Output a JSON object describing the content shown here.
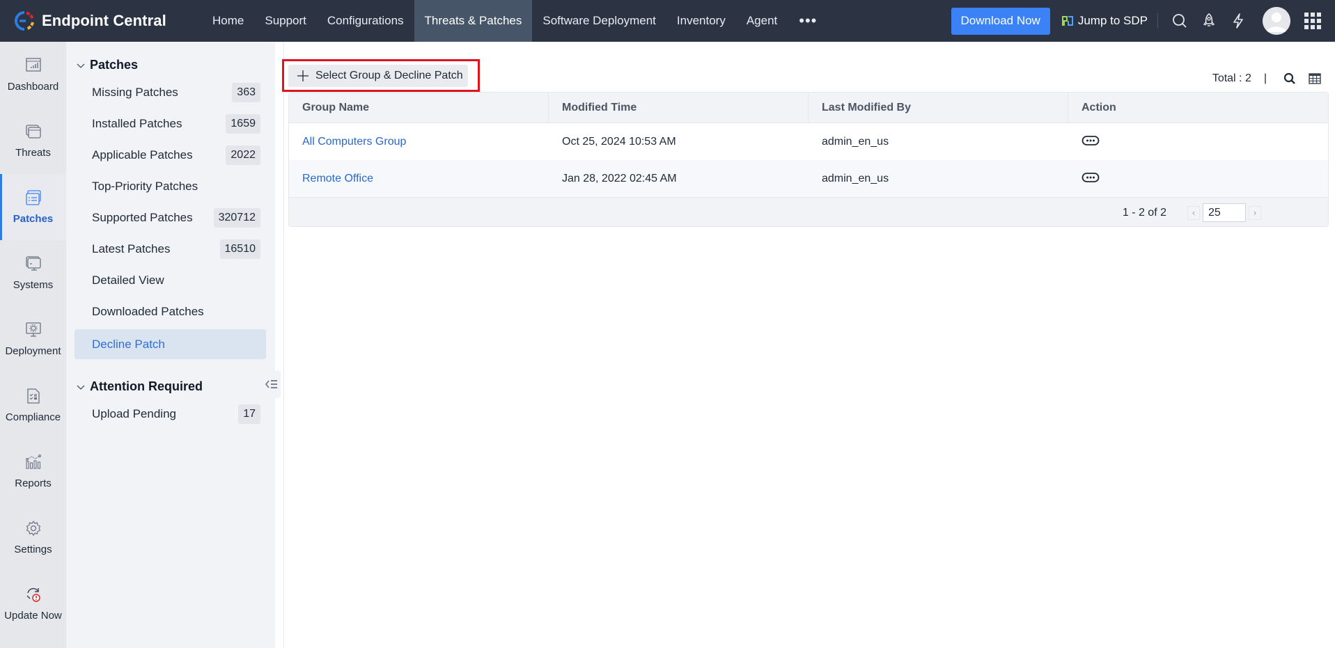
{
  "app": {
    "name": "Endpoint Central",
    "logo_colors": [
      "#2f7de1",
      "#d8262f",
      "#f0b445"
    ]
  },
  "topnav": {
    "items": [
      {
        "label": "Home",
        "active": false
      },
      {
        "label": "Support",
        "active": false
      },
      {
        "label": "Configurations",
        "active": false
      },
      {
        "label": "Threats & Patches",
        "active": true
      },
      {
        "label": "Software Deployment",
        "active": false
      },
      {
        "label": "Inventory",
        "active": false
      },
      {
        "label": "Agent",
        "active": false
      }
    ],
    "more_label": "•••",
    "download_label": "Download Now",
    "jump_label": "Jump to SDP",
    "icons": [
      "search-icon",
      "rocket-icon",
      "lightning-icon",
      "avatar",
      "apps-grid-icon"
    ]
  },
  "rail": {
    "items": [
      {
        "label": "Dashboard",
        "icon": "dashboard-icon",
        "active": false
      },
      {
        "label": "Threats",
        "icon": "threats-icon",
        "active": false
      },
      {
        "label": "Patches",
        "icon": "patches-icon",
        "active": true
      },
      {
        "label": "Systems",
        "icon": "systems-icon",
        "active": false
      },
      {
        "label": "Deployment",
        "icon": "deployment-icon",
        "active": false
      },
      {
        "label": "Compliance",
        "icon": "compliance-icon",
        "active": false
      },
      {
        "label": "Reports",
        "icon": "reports-icon",
        "active": false
      },
      {
        "label": "Settings",
        "icon": "settings-icon",
        "active": false
      },
      {
        "label": "Update Now",
        "icon": "update-now-icon",
        "active": false
      }
    ]
  },
  "subnav": {
    "sections": [
      {
        "title": "Patches",
        "items": [
          {
            "label": "Missing Patches",
            "count": "363"
          },
          {
            "label": "Installed Patches",
            "count": "1659"
          },
          {
            "label": "Applicable Patches",
            "count": "2022"
          },
          {
            "label": "Top-Priority Patches",
            "count": null
          },
          {
            "label": "Supported Patches",
            "count": "320712"
          },
          {
            "label": "Latest Patches",
            "count": "16510"
          },
          {
            "label": "Detailed View",
            "count": null
          },
          {
            "label": "Downloaded Patches",
            "count": null
          },
          {
            "label": "Decline Patch",
            "count": null,
            "active": true
          }
        ]
      },
      {
        "title": "Attention Required",
        "items": [
          {
            "label": "Upload Pending",
            "count": "17"
          }
        ]
      }
    ]
  },
  "main": {
    "action_button_label": "Select Group & Decline Patch",
    "total_label": "Total : 2",
    "separator": "|",
    "table": {
      "columns": [
        "Group Name",
        "Modified Time",
        "Last Modified By",
        "Action"
      ],
      "rows": [
        {
          "group_name": "All Computers Group",
          "modified_time": "Oct 25, 2024 10:53 AM",
          "last_modified_by": "admin_en_us"
        },
        {
          "group_name": "Remote Office",
          "modified_time": "Jan 28, 2022 02:45 AM",
          "last_modified_by": "admin_en_us"
        }
      ],
      "pagination": {
        "range_label": "1 - 2 of 2",
        "page_size": "25",
        "prev": "‹",
        "next": "›"
      }
    },
    "highlight_color": "#e0141e"
  }
}
